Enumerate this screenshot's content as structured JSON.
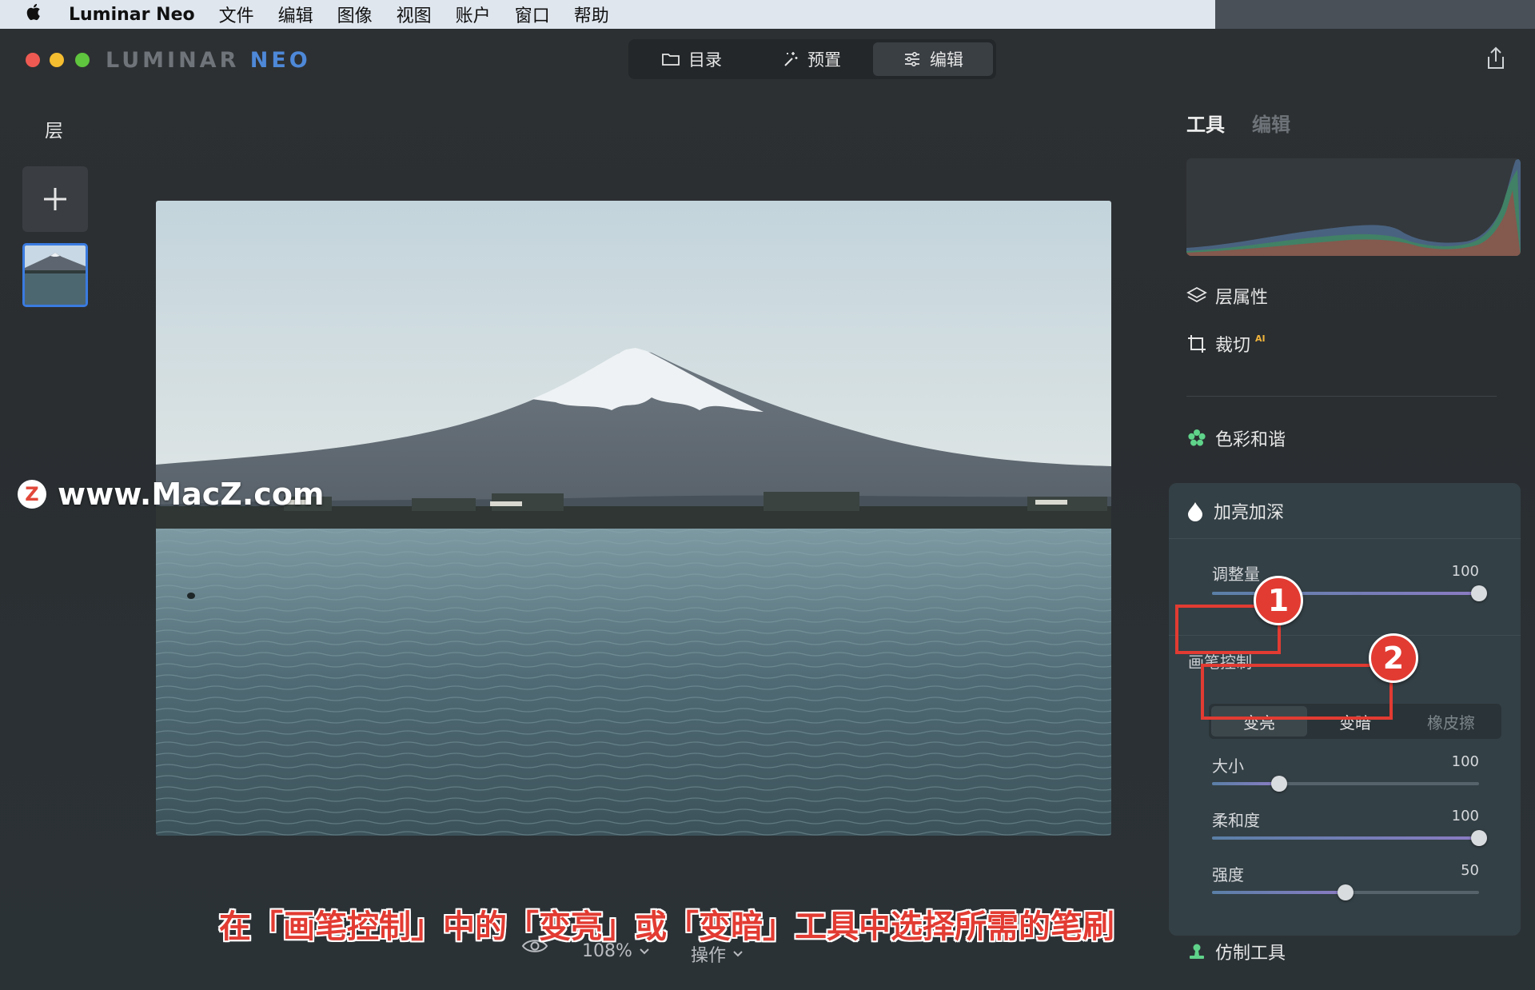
{
  "menubar": {
    "apple_icon": "apple-icon",
    "app_name": "Luminar Neo",
    "items": [
      "文件",
      "编辑",
      "图像",
      "视图",
      "账户",
      "窗口",
      "帮助"
    ]
  },
  "titlebar": {
    "logo_part1": "LUMINAR ",
    "logo_part2": "NEO",
    "tabs": [
      {
        "label": "目录",
        "icon": "folder-icon",
        "active": false
      },
      {
        "label": "预置",
        "icon": "magic-wand-icon",
        "active": false
      },
      {
        "label": "编辑",
        "icon": "sliders-icon",
        "active": true
      }
    ]
  },
  "layers": {
    "title": "层"
  },
  "watermark": {
    "badge": "Z",
    "text": "www.MacZ.com"
  },
  "bottom": {
    "zoom": "108%",
    "actions": "操作"
  },
  "caption": "在「画笔控制」中的「变亮」或「变暗」工具中选择所需的笔刷",
  "right_panel": {
    "tabs": [
      {
        "label": "工具",
        "active": true
      },
      {
        "label": "编辑",
        "active": false
      }
    ],
    "tools": {
      "layer_properties": "层属性",
      "crop": "裁切",
      "crop_badge": "AI",
      "color_harmony": "色彩和谐",
      "dodge_burn": "加亮加深",
      "clone": "仿制工具"
    },
    "dodge": {
      "amount_label": "调整量",
      "amount_value": "100",
      "amount_fraction": 1.0,
      "brush_control_label": "画笔控制",
      "modes": [
        "变亮",
        "变暗",
        "橡皮擦"
      ],
      "active_mode": "变亮",
      "size_label": "大小",
      "size_value": "100",
      "size_fraction": 0.25,
      "softness_label": "柔和度",
      "softness_value": "100",
      "softness_fraction": 1.0,
      "strength_label": "强度",
      "strength_value": "50",
      "strength_fraction": 0.5
    },
    "annotations": [
      "1",
      "2"
    ]
  },
  "colors": {
    "accent_red": "#e23b32",
    "selection_blue": "#3a7be0",
    "harmony_green": "#5fd38a",
    "crop_ai_orange": "#f0b43c"
  }
}
